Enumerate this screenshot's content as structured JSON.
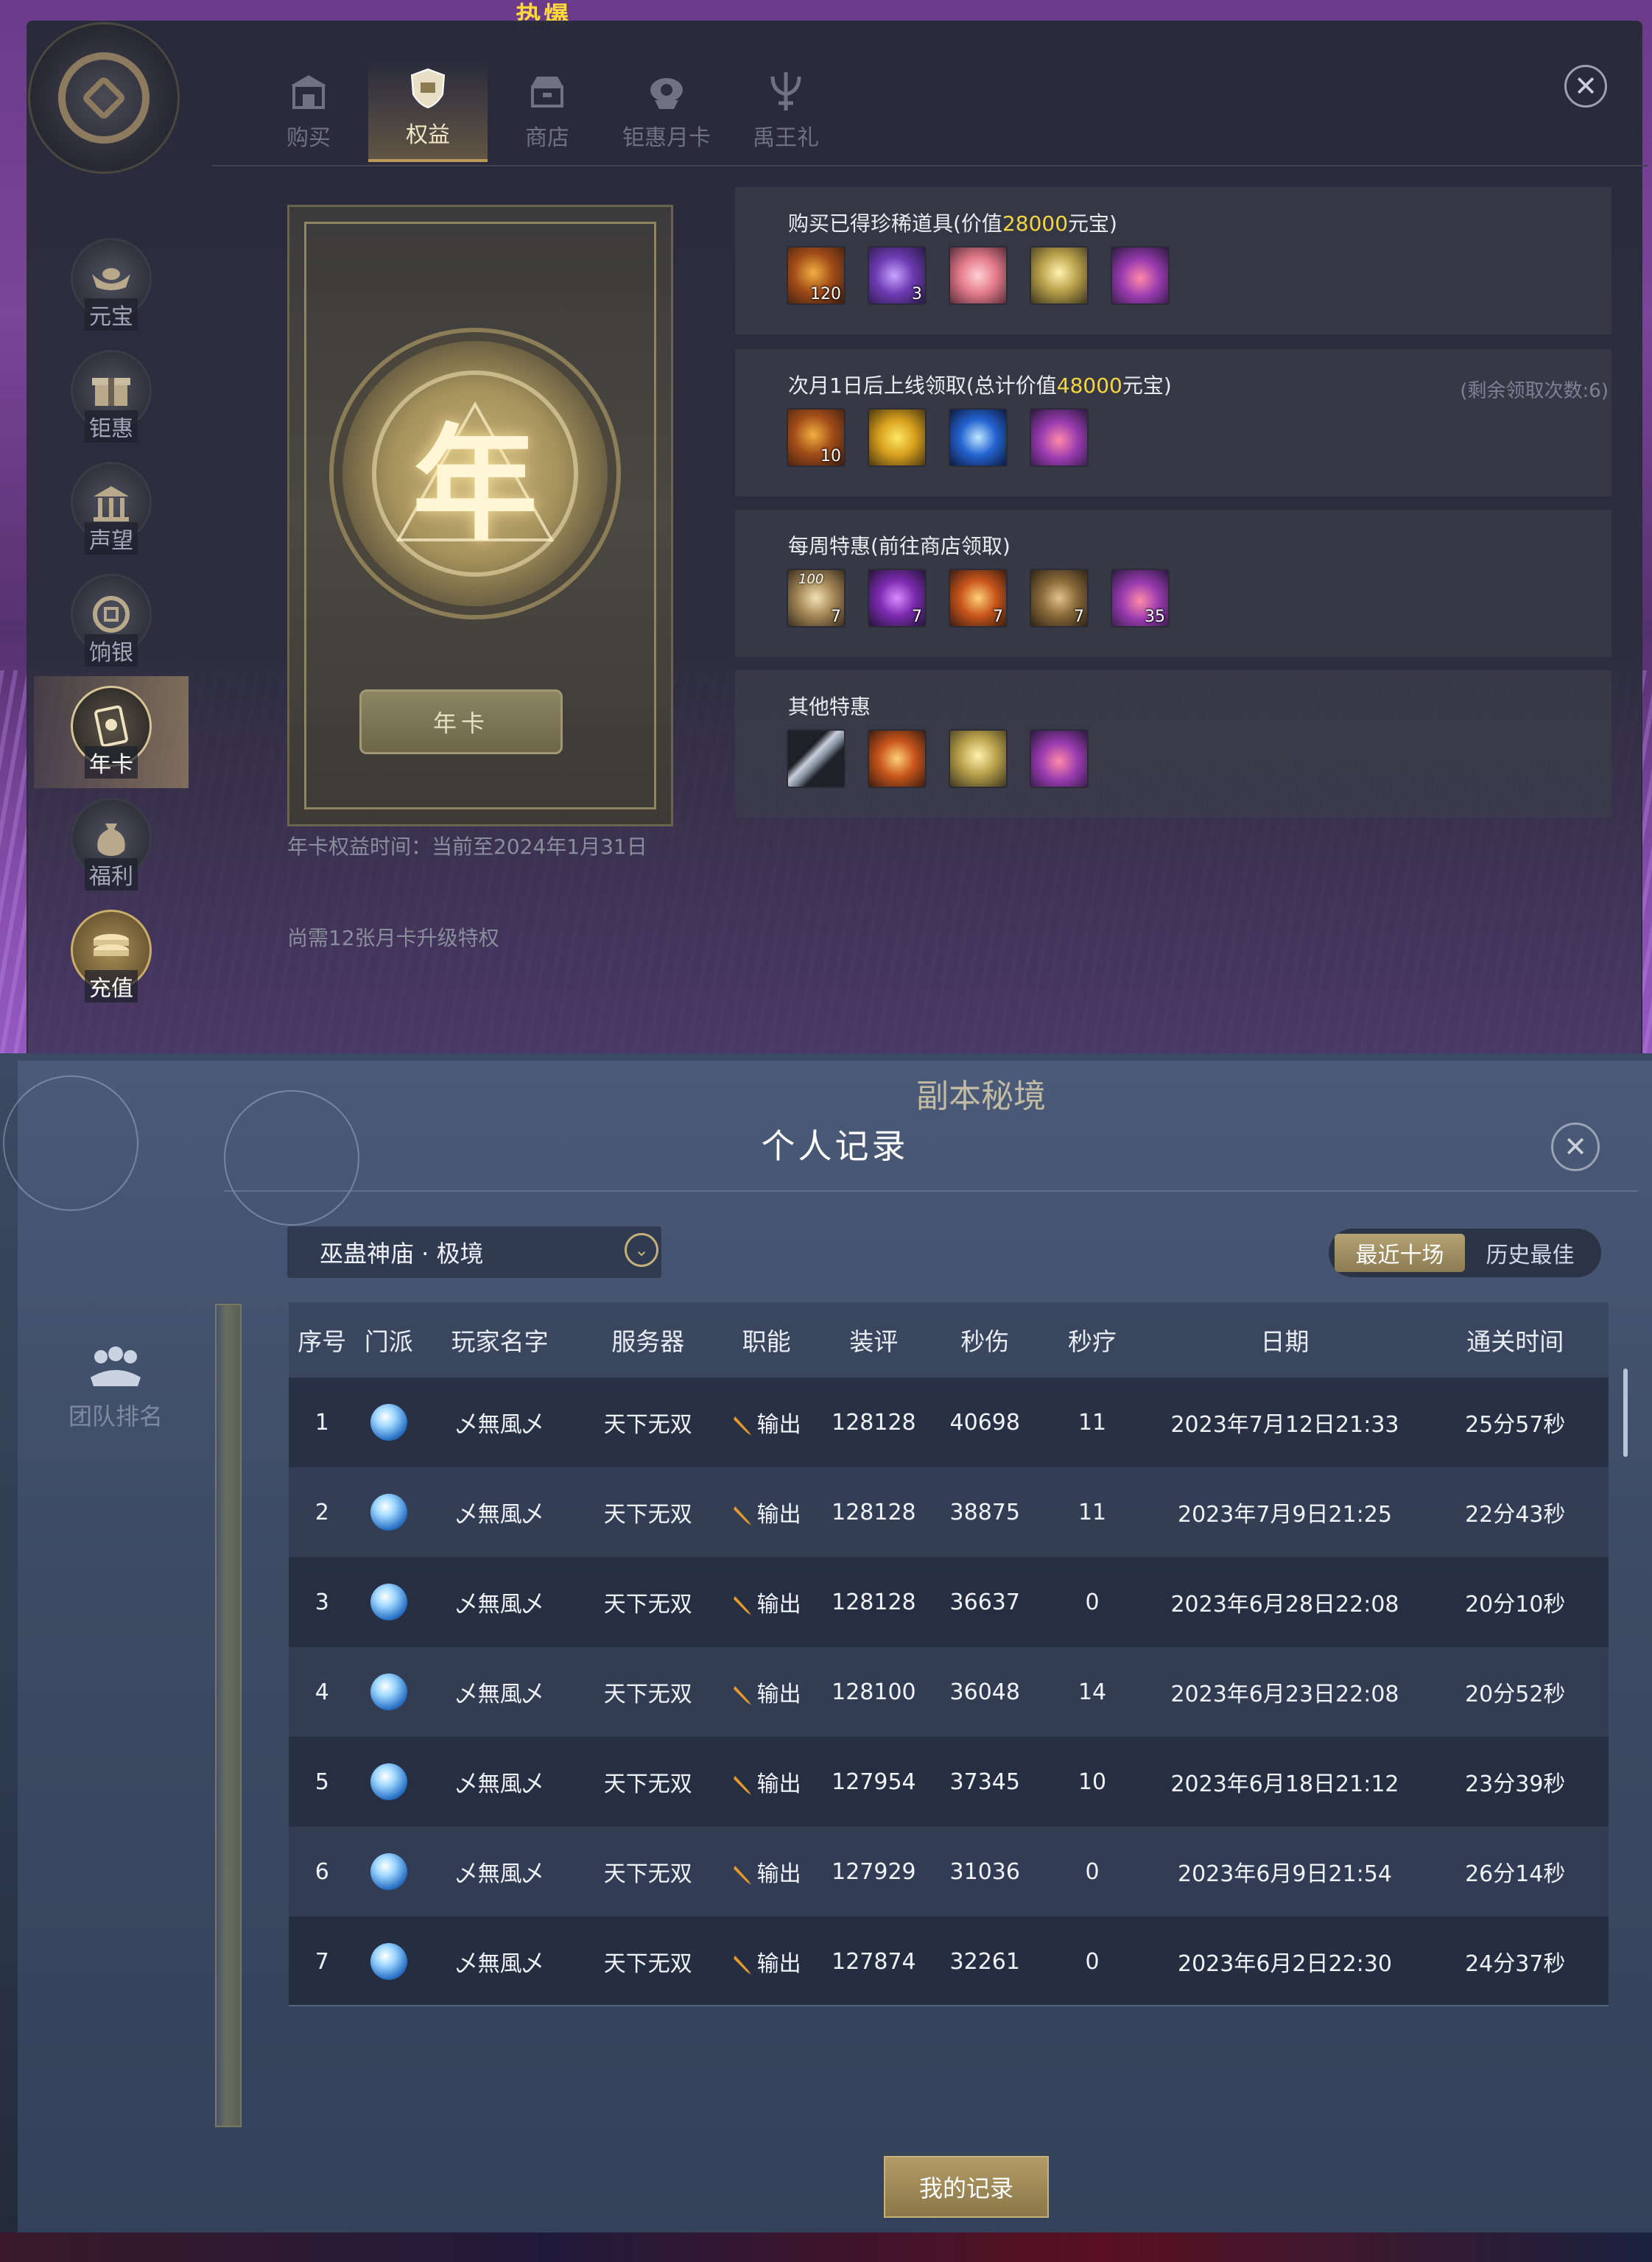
{
  "top": {
    "banner_text": "热爆",
    "tabs": [
      {
        "label": "购买",
        "icon": "storefront-icon"
      },
      {
        "label": "权益",
        "icon": "shield-badge-icon",
        "active": true
      },
      {
        "label": "商店",
        "icon": "shop-icon"
      },
      {
        "label": "钜惠月卡",
        "icon": "monthly-card-icon"
      },
      {
        "label": "禹王礼",
        "icon": "trident-gift-icon"
      }
    ],
    "sidebar": [
      {
        "label": "元宝",
        "icon": "ingot-icon"
      },
      {
        "label": "钜惠",
        "icon": "gift-box-icon"
      },
      {
        "label": "声望",
        "icon": "temple-icon"
      },
      {
        "label": "饷银",
        "icon": "coin-icon"
      },
      {
        "label": "年卡",
        "icon": "annual-card-icon",
        "active": true
      },
      {
        "label": "福利",
        "icon": "money-bag-icon"
      },
      {
        "label": "充值",
        "icon": "coin-stack-icon"
      }
    ],
    "card": {
      "emblem_char": "年",
      "button_label": "年卡",
      "validity": "年卡权益时间：当前至2024年1月31日",
      "upgrade_note": "尚需12张月卡升级特权"
    },
    "benefits": [
      {
        "title_prefix": "购买已得珍稀道具(价值",
        "title_highlight": "28000",
        "title_suffix": "元宝)",
        "note": "",
        "items": [
          {
            "icon": "sun-medal-icon",
            "count": "120"
          },
          {
            "icon": "treasure-chest-icon",
            "count": "3"
          },
          {
            "icon": "pink-lantern-icon",
            "count": ""
          },
          {
            "icon": "gold-horse-icon",
            "count": ""
          },
          {
            "icon": "lucky-bag-icon",
            "count": ""
          }
        ]
      },
      {
        "title_prefix": "次月1日后上线领取(总计价值",
        "title_highlight": "48000",
        "title_suffix": "元宝)",
        "note": "(剩余领取次数:6)",
        "items": [
          {
            "icon": "sun-medal-icon",
            "count": "10"
          },
          {
            "icon": "gold-ingot-icon",
            "count": ""
          },
          {
            "icon": "blue-crystal-icon",
            "count": ""
          },
          {
            "icon": "lucky-bag-icon",
            "count": ""
          }
        ]
      },
      {
        "title_prefix": "每周特惠(前往商店领取)",
        "title_highlight": "",
        "title_suffix": "",
        "note": "",
        "items": [
          {
            "icon": "scroll-icon",
            "count": "7",
            "top": "100"
          },
          {
            "icon": "purple-potion-icon",
            "count": "7"
          },
          {
            "icon": "amber-jar-icon",
            "count": "7"
          },
          {
            "icon": "parchment-icon",
            "count": "7"
          },
          {
            "icon": "pink-orb-icon",
            "count": "35"
          }
        ]
      },
      {
        "title_prefix": "其他特惠",
        "title_highlight": "",
        "title_suffix": "",
        "note": "",
        "items": [
          {
            "icon": "blade-icon",
            "count": ""
          },
          {
            "icon": "amber-talisman-icon",
            "count": ""
          },
          {
            "icon": "gold-horse-icon",
            "count": ""
          },
          {
            "icon": "lucky-bag-icon",
            "count": ""
          }
        ]
      }
    ]
  },
  "bottom": {
    "bg_title": "副本秘境",
    "title": "个人记录",
    "side_nav_label": "团队排名",
    "dropdown_value": "巫蛊神庙 · 极境",
    "segments": [
      "最近十场",
      "历史最佳"
    ],
    "columns": [
      "序号",
      "门派",
      "玩家名字",
      "服务器",
      "职能",
      "装评",
      "秒伤",
      "秒疗",
      "日期",
      "通关时间"
    ],
    "rows": [
      {
        "no": "1",
        "name": "乄無風乄",
        "server": "天下无双",
        "role": "输出",
        "gear": "128128",
        "dps": "40698",
        "hps": "11",
        "date": "2023年7月12日21:33",
        "time": "25分57秒"
      },
      {
        "no": "2",
        "name": "乄無風乄",
        "server": "天下无双",
        "role": "输出",
        "gear": "128128",
        "dps": "38875",
        "hps": "11",
        "date": "2023年7月9日21:25",
        "time": "22分43秒"
      },
      {
        "no": "3",
        "name": "乄無風乄",
        "server": "天下无双",
        "role": "输出",
        "gear": "128128",
        "dps": "36637",
        "hps": "0",
        "date": "2023年6月28日22:08",
        "time": "20分10秒"
      },
      {
        "no": "4",
        "name": "乄無風乄",
        "server": "天下无双",
        "role": "输出",
        "gear": "128100",
        "dps": "36048",
        "hps": "14",
        "date": "2023年6月23日22:08",
        "time": "20分52秒"
      },
      {
        "no": "5",
        "name": "乄無風乄",
        "server": "天下无双",
        "role": "输出",
        "gear": "127954",
        "dps": "37345",
        "hps": "10",
        "date": "2023年6月18日21:12",
        "time": "23分39秒"
      },
      {
        "no": "6",
        "name": "乄無風乄",
        "server": "天下无双",
        "role": "输出",
        "gear": "127929",
        "dps": "31036",
        "hps": "0",
        "date": "2023年6月9日21:54",
        "time": "26分14秒"
      },
      {
        "no": "7",
        "name": "乄無風乄",
        "server": "天下无双",
        "role": "输出",
        "gear": "127874",
        "dps": "32261",
        "hps": "0",
        "date": "2023年6月2日22:30",
        "time": "24分37秒"
      }
    ],
    "my_record_button": "我的记录"
  },
  "colors": {
    "highlight": "#f4d640",
    "gold_accent": "#b99a5b",
    "panel_dark": "#262939"
  }
}
